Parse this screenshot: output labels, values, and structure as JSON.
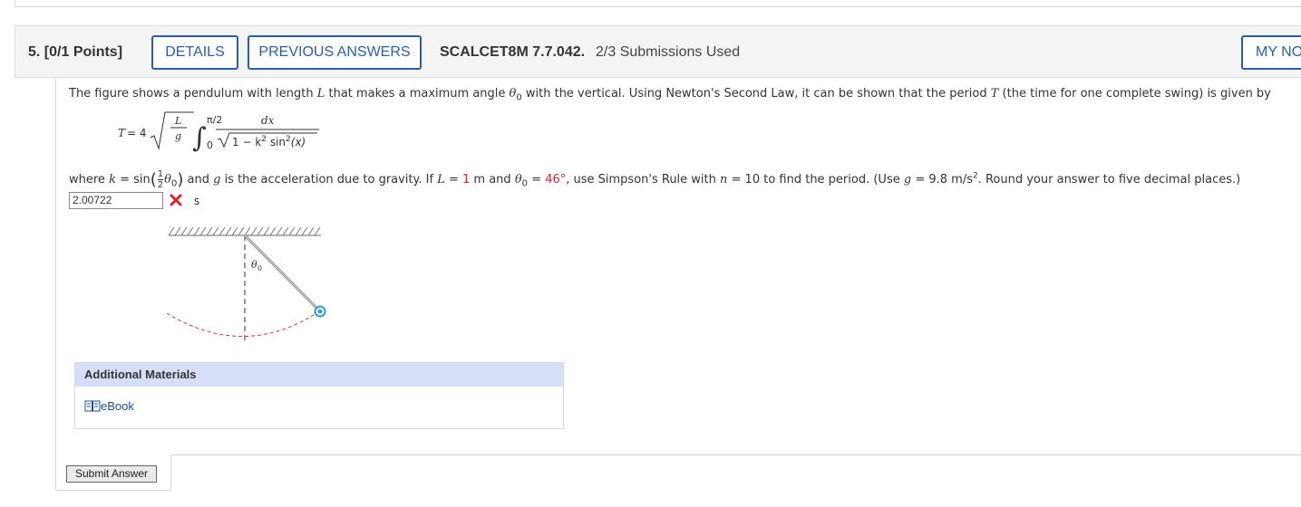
{
  "question": {
    "number": "5.",
    "points": "[0/1 Points]",
    "details_label": "DETAILS",
    "previous_answers_label": "PREVIOUS ANSWERS",
    "code": "SCALCET8M 7.7.042.",
    "submissions": "2/3 Submissions Used",
    "my_notes_label": "MY NO"
  },
  "problem": {
    "line1_pre": "The figure shows a pendulum with length ",
    "L": "L",
    "line1_mid": " that makes a maximum angle ",
    "theta0": "θ",
    "theta_sub": "0",
    "line1_post": " with the vertical. Using Newton's Second Law, it can be shown that the period ",
    "T": "T",
    "line1_end": " (the time for one complete swing) is given by",
    "where_pre": "where ",
    "k_eq": "k",
    "where_sin": " = sin",
    "where_mid": " and ",
    "g": "g",
    "where_mid2": " is the acceleration due to gravity. If ",
    "L_eq": " = ",
    "L_val": "1",
    "L_unit": " m and ",
    "theta_eq": " = ",
    "theta_val": "46°",
    "use_text": ", use Simpson's Rule with ",
    "n": "n",
    "n_eq": " = 10 to find the period. (Use ",
    "g_val": " = 9.8 m/s",
    "sup2": "2",
    "round_text": ". Round your answer to five decimal places.)"
  },
  "formula": {
    "T": "T",
    "eq4": "= 4",
    "L": "L",
    "g": "g",
    "upper": "π/2",
    "lower": "0",
    "dx": "dx",
    "denom": "1 − k",
    "denom_sup": "2",
    "denom_post": " sin",
    "denom_sup2": "2",
    "denom_x": "(x)"
  },
  "answer": {
    "value": "2.00722",
    "unit": "s",
    "status": "incorrect"
  },
  "figure": {
    "theta_label": "θ",
    "theta_sub": "0"
  },
  "additional_materials": {
    "title": "Additional Materials",
    "ebook_label": "eBook"
  },
  "submit_label": "Submit Answer",
  "colors": {
    "accent": "#2a5db0",
    "incorrect": "#d4262b",
    "materials_header": "#d7def7"
  }
}
